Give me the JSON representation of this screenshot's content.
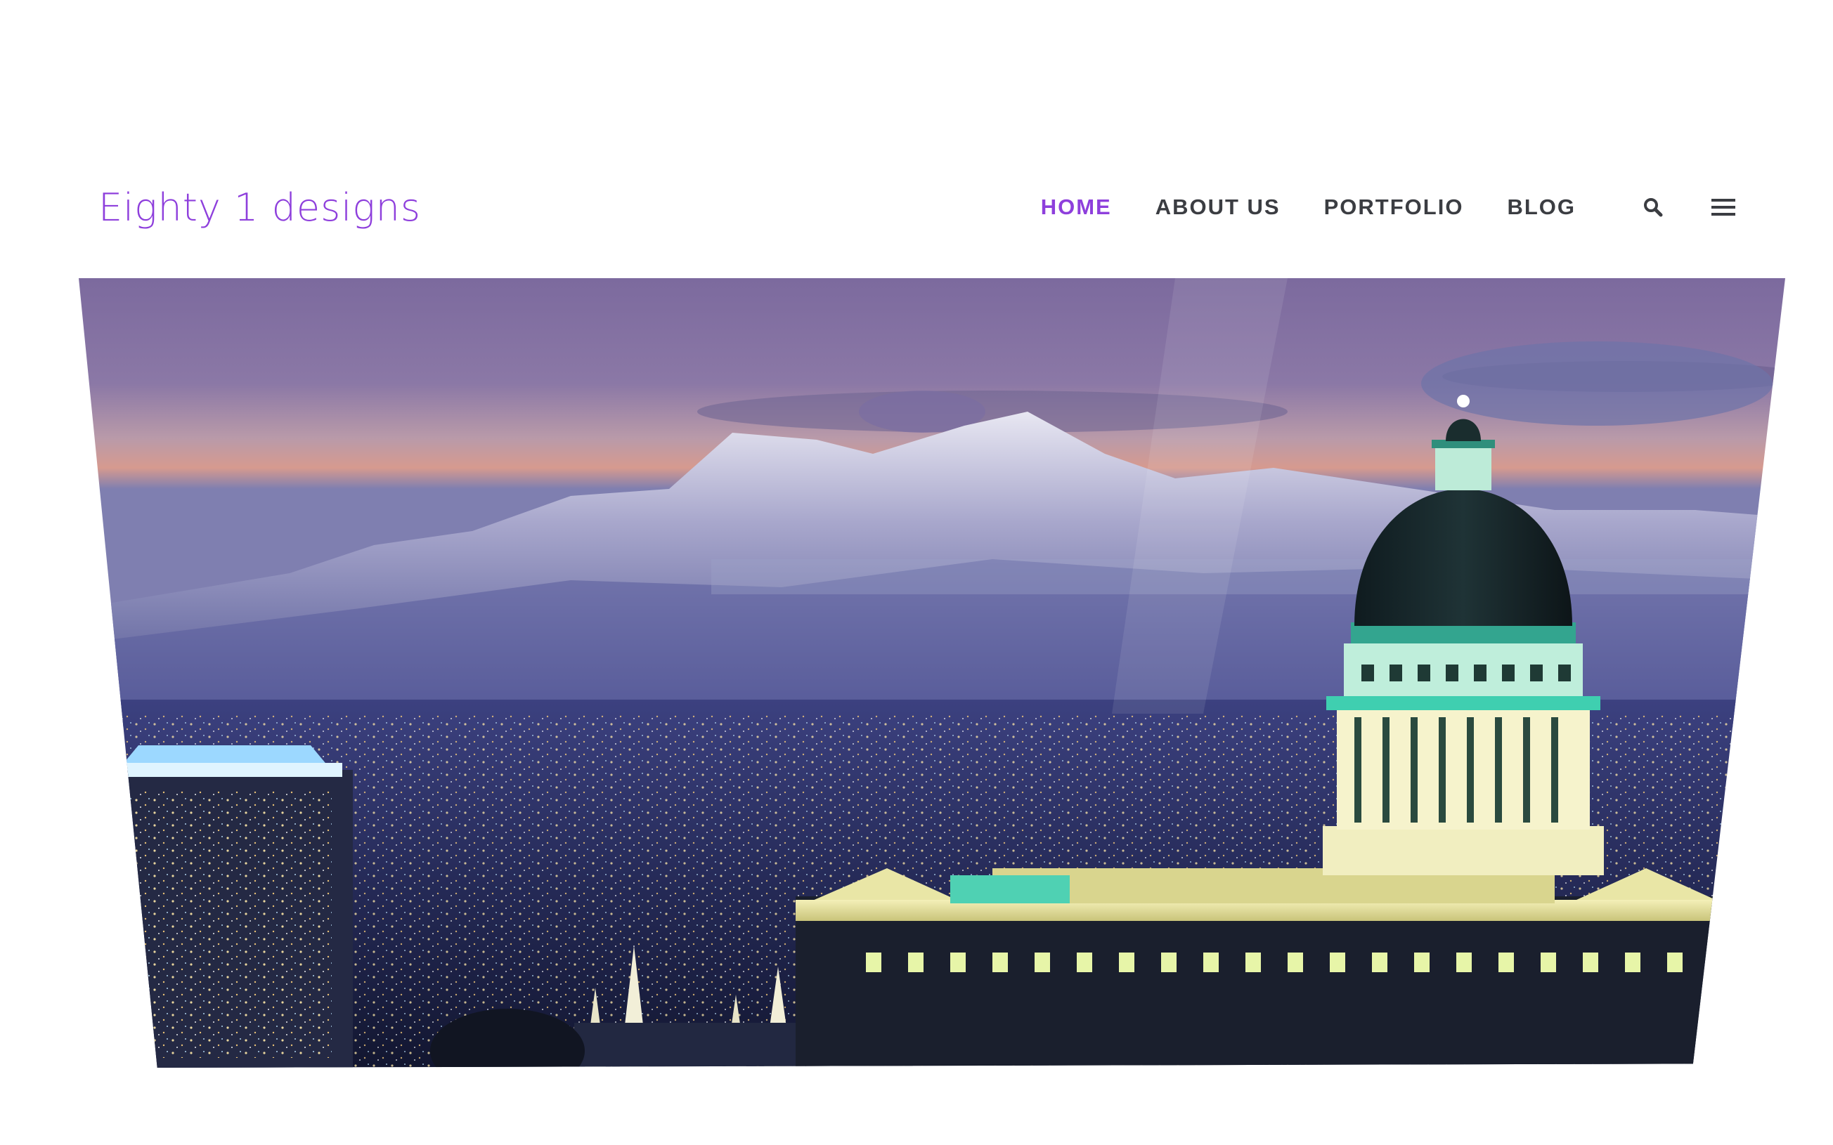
{
  "brand": {
    "logo_text": "Eighty 1 designs",
    "accent_color": "#8e3fdc"
  },
  "nav": {
    "items": [
      {
        "label": "HOME",
        "active": true
      },
      {
        "label": "ABOUT US",
        "active": false
      },
      {
        "label": "PORTFOLIO",
        "active": false
      },
      {
        "label": "BLOG",
        "active": false
      }
    ],
    "search_icon": "search-icon",
    "menu_icon": "hamburger-menu-icon",
    "text_color": "#3b3d42"
  },
  "hero": {
    "image_subject": "Utah State Capitol at dusk with snow-capped mountains and city lights"
  }
}
